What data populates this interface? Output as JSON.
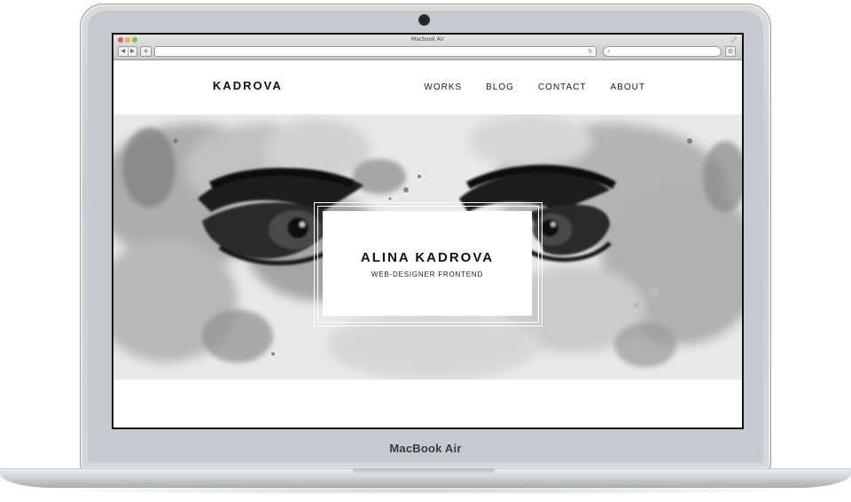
{
  "device": {
    "brand_label": "MacBook Air"
  },
  "browser": {
    "window_title": "Macbook Air",
    "nav_back": "◀",
    "nav_forward": "▶",
    "add_tab": "+",
    "reload": "↻",
    "search_glyph": "⌕",
    "settings_glyph": "⚙",
    "fullscreen_glyph": "⤢"
  },
  "site": {
    "logo": "KADROVA",
    "nav": [
      "WORKS",
      "BLOG",
      "CONTACT",
      "ABOUT"
    ],
    "hero": {
      "name": "ALINA KADROVA",
      "subtitle": "WEB-DESIGNER FRONTEND"
    }
  },
  "colors": {
    "page_bg": "#ffffff",
    "text": "#111111",
    "traffic_red": "#e25b4f",
    "traffic_yellow": "#e6b64a",
    "traffic_green": "#7dbf4e"
  }
}
